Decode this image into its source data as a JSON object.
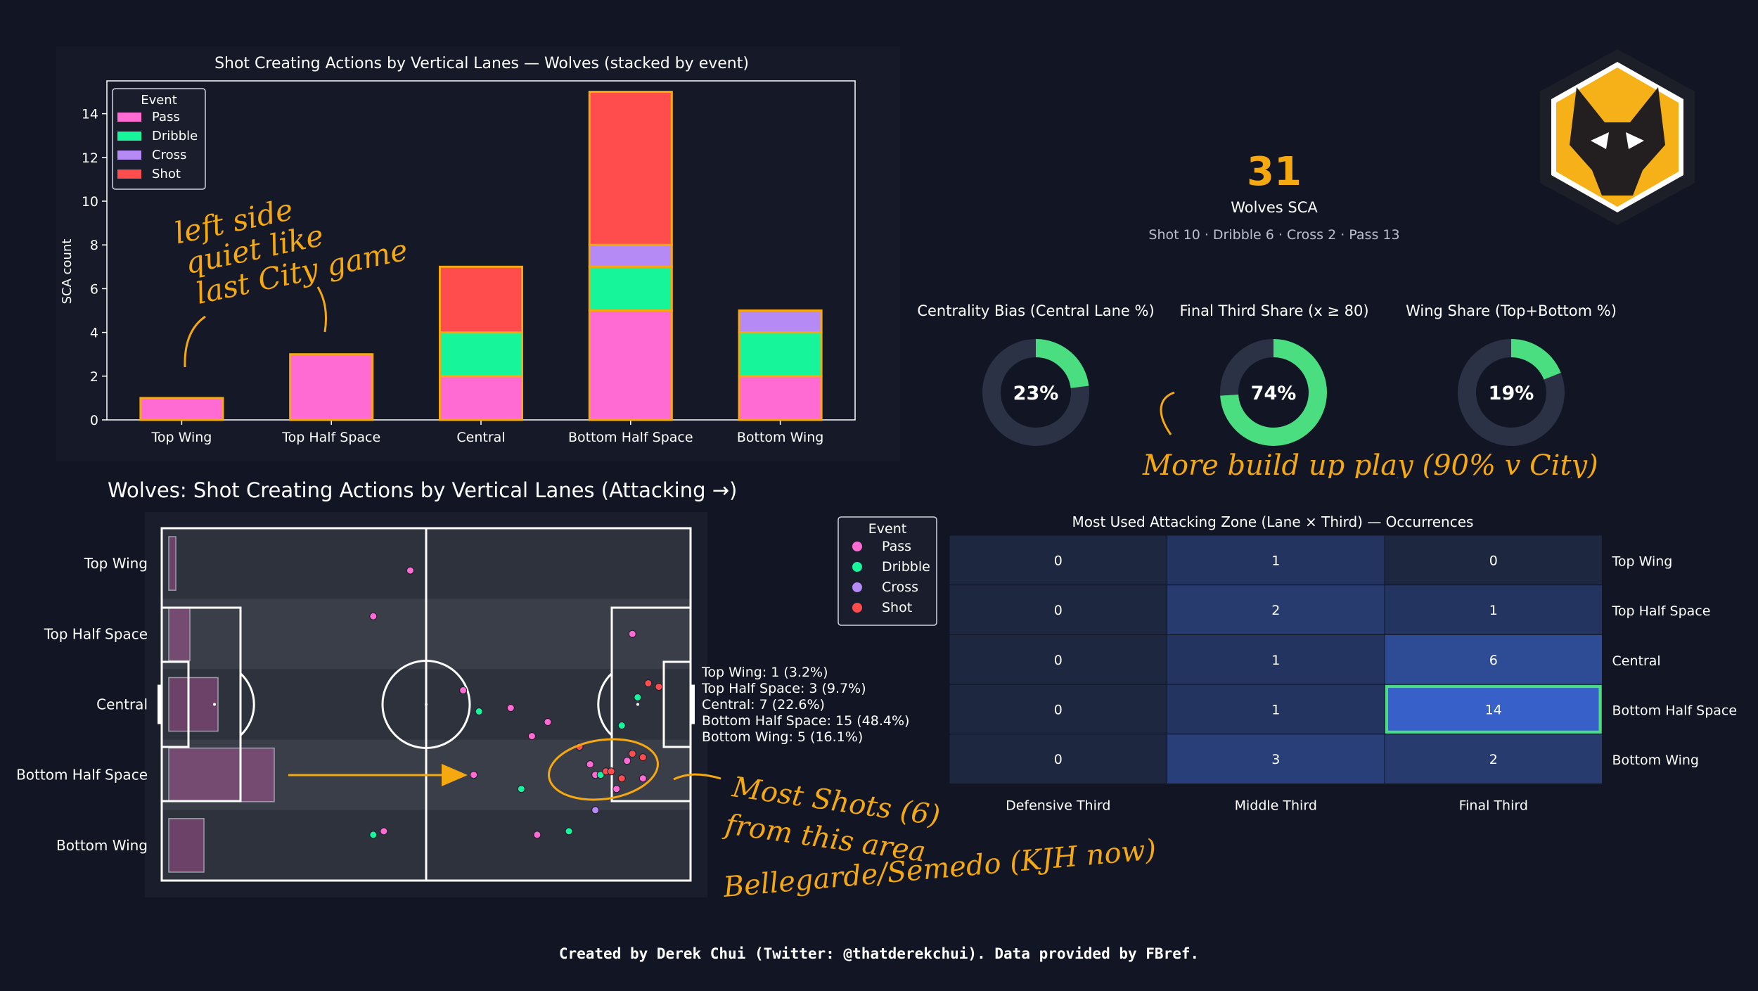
{
  "colors": {
    "background": "#121624",
    "panel": "#161a28",
    "pass": "#ff6bd2",
    "dribble": "#16f59a",
    "cross": "#b58af5",
    "shot": "#ff4d4d",
    "accent": "#f5a80f",
    "donut_fill": "#4ade80",
    "donut_track": "#2b3246",
    "heat_low": "#1e2740",
    "heat_high": "#3760c8",
    "highlight": "#4ade80"
  },
  "bar_panel": {
    "title": "Shot Creating Actions by Vertical Lanes — Wolves (stacked by event)",
    "ylabel": "SCA count",
    "legend_title": "Event",
    "annotation": "left side quiet like last City game"
  },
  "chart_data": [
    {
      "type": "bar",
      "stacked": true,
      "title": "Shot Creating Actions by Vertical Lanes — Wolves (stacked by event)",
      "categories": [
        "Top Wing",
        "Top Half Space",
        "Central",
        "Bottom Half Space",
        "Bottom Wing"
      ],
      "series": [
        {
          "name": "Pass",
          "values": [
            1,
            3,
            2,
            5,
            2
          ]
        },
        {
          "name": "Dribble",
          "values": [
            0,
            0,
            2,
            2,
            2
          ]
        },
        {
          "name": "Cross",
          "values": [
            0,
            0,
            0,
            1,
            1
          ]
        },
        {
          "name": "Shot",
          "values": [
            0,
            0,
            3,
            7,
            0
          ]
        }
      ],
      "xlabel": "",
      "ylabel": "SCA count",
      "ylim": [
        0,
        15.5
      ],
      "yticks": [
        0,
        2,
        4,
        6,
        8,
        10,
        12,
        14
      ],
      "legend": "top-left",
      "grid": false
    },
    {
      "type": "heatmap",
      "title": "Most Used Attacking Zone (Lane × Third) — Occurrences",
      "rows": [
        "Top Wing",
        "Top Half Space",
        "Central",
        "Bottom Half Space",
        "Bottom Wing"
      ],
      "columns": [
        "Defensive Third",
        "Middle Third",
        "Final Third"
      ],
      "values": [
        [
          0,
          1,
          0
        ],
        [
          0,
          2,
          1
        ],
        [
          0,
          1,
          6
        ],
        [
          0,
          1,
          14
        ],
        [
          0,
          3,
          2
        ]
      ],
      "highlight": {
        "row": 3,
        "col": 2
      }
    },
    {
      "type": "scatter",
      "title": "Wolves: Shot Creating Actions by Vertical Lanes (Attacking →)",
      "lanes": [
        "Top Wing",
        "Top Half Space",
        "Central",
        "Bottom Half Space",
        "Bottom Wing"
      ],
      "lane_summary": [
        "Top Wing: 1 (3.2%)",
        "Top Half Space: 3 (9.7%)",
        "Central: 7 (22.6%)",
        "Bottom Half Space: 15 (48.4%)",
        "Bottom Wing: 5 (16.1%)"
      ],
      "lane_bar_values": [
        1,
        3,
        7,
        15,
        5
      ],
      "points": [
        {
          "x": 47,
          "y": 88,
          "event": "Pass"
        },
        {
          "x": 40,
          "y": 75,
          "event": "Pass"
        },
        {
          "x": 57,
          "y": 54,
          "event": "Pass"
        },
        {
          "x": 59,
          "y": 30,
          "event": "Pass"
        },
        {
          "x": 42,
          "y": 14,
          "event": "Pass"
        },
        {
          "x": 40,
          "y": 13,
          "event": "Dribble"
        },
        {
          "x": 66,
          "y": 49,
          "event": "Pass"
        },
        {
          "x": 68,
          "y": 26,
          "event": "Dribble"
        },
        {
          "x": 70,
          "y": 41,
          "event": "Pass"
        },
        {
          "x": 60,
          "y": 48,
          "event": "Dribble"
        },
        {
          "x": 73,
          "y": 45,
          "event": "Pass"
        },
        {
          "x": 71,
          "y": 13,
          "event": "Pass"
        },
        {
          "x": 77,
          "y": 14,
          "event": "Dribble"
        },
        {
          "x": 87,
          "y": 44,
          "event": "Dribble"
        },
        {
          "x": 89,
          "y": 70,
          "event": "Pass"
        },
        {
          "x": 81,
          "y": 33,
          "event": "Pass"
        },
        {
          "x": 82,
          "y": 30,
          "event": "Pass"
        },
        {
          "x": 83,
          "y": 30,
          "event": "Dribble"
        },
        {
          "x": 84,
          "y": 31,
          "event": "Shot"
        },
        {
          "x": 85,
          "y": 31,
          "event": "Shot"
        },
        {
          "x": 87,
          "y": 29,
          "event": "Shot"
        },
        {
          "x": 88,
          "y": 34,
          "event": "Pass"
        },
        {
          "x": 89,
          "y": 36,
          "event": "Shot"
        },
        {
          "x": 91,
          "y": 35,
          "event": "Shot"
        },
        {
          "x": 91,
          "y": 29,
          "event": "Pass"
        },
        {
          "x": 86,
          "y": 26,
          "event": "Pass"
        },
        {
          "x": 82,
          "y": 20,
          "event": "Cross"
        },
        {
          "x": 92,
          "y": 56,
          "event": "Shot"
        },
        {
          "x": 94,
          "y": 55,
          "event": "Shot"
        },
        {
          "x": 90,
          "y": 52,
          "event": "Dribble"
        },
        {
          "x": 79,
          "y": 38,
          "event": "Shot"
        }
      ]
    }
  ],
  "pitch_panel": {
    "title": "Wolves: Shot Creating Actions by Vertical Lanes (Attacking →)",
    "legend_title": "Event",
    "legend": [
      "Pass",
      "Dribble",
      "Cross",
      "Shot"
    ],
    "annotation": "Most Shots (6) from this area Bellegarde/Semedo (KJH now)"
  },
  "kpi": {
    "total": "31",
    "label": "Wolves SCA",
    "breakdown": "Shot 10 · Dribble 6 · Cross 2 · Pass 13"
  },
  "donuts": [
    {
      "title": "Centrality Bias (Central Lane %)",
      "value": 23,
      "label": "23%"
    },
    {
      "title": "Final Third Share (x ≥ 80)",
      "value": 74,
      "label": "74%"
    },
    {
      "title": "Wing Share (Top+Bottom %)",
      "value": 19,
      "label": "19%"
    }
  ],
  "donut_annotation": "More build up play (90% v City)",
  "heatmap_panel": {
    "title": "Most Used Attacking Zone (Lane × Third) — Occurrences"
  },
  "footer": "Created by Derek Chui (Twitter: @thatderekchui). Data provided by FBref."
}
